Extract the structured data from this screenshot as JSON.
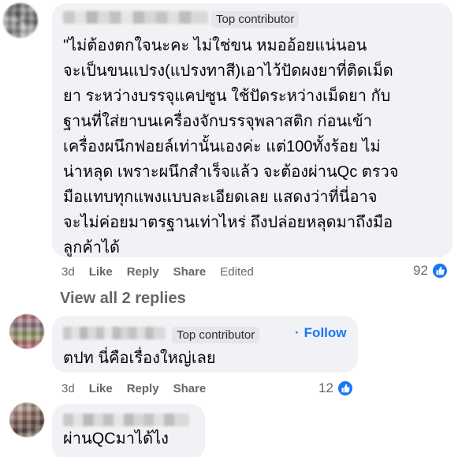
{
  "comments": [
    {
      "badge": "Top contributor",
      "text": "\"ไม่ต้องตกใจนะคะ ไม่ใช่ขน หมออ้อยแน่นอน\nจะเป็นขนแปรง(แปรงทาสี)เอาไว้ปัดผงยาที่ติดเม็ด\nยา ระหว่างบรรจุแคปซูน ใช้ปัดระหว่างเม็ดยา กับ\nฐานที่ใส่ยาบนเครื่องจักบรรจุพลาสติก ก่อนเข้า\nเครื่องผนึกฟอยล์เท่านั้นเองค่ะ แต่100ทั้งร้อย ไม่\nน่าหลุด เพราะผนึกสำเร็จแล้ว จะต้องผ่านQc ตรวจ\nมือแทบทุกแพงแบบละเอียดเลย แสดงว่าที่นี่อาจ\nจะไม่ค่อยมาตรฐานเท่าไหร่ ถึงปล่อยหลุดมาถึงมือ\nลูกค้าได้",
      "time": "3d",
      "like": "Like",
      "reply": "Reply",
      "share": "Share",
      "edited": "Edited",
      "reactions": "92"
    },
    {
      "badge": "Top contributor",
      "follow": "Follow",
      "text": "ตปท นี่คือเรื่องใหญ่เลย",
      "time": "3d",
      "like": "Like",
      "reply": "Reply",
      "share": "Share",
      "reactions": "12"
    },
    {
      "text": "ผ่านQCมาได้ไง"
    }
  ],
  "view_replies": "View all 2 replies",
  "icons": {
    "reaction": "like-thumb-icon",
    "avatar": "avatar-icon"
  },
  "colors": {
    "bubble": "#f0f2f5",
    "accent": "#1877f2",
    "muted_text": "#65676b"
  }
}
